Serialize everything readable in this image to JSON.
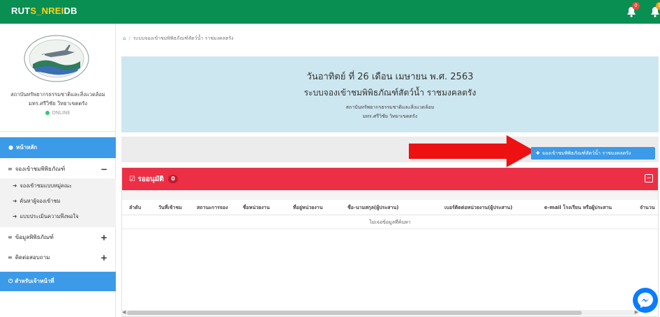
{
  "brand": {
    "part1": "RUT",
    "part2": "S_NREI",
    "part3": "DB"
  },
  "notifications": [
    {
      "count": "0"
    },
    {
      "count": "0"
    }
  ],
  "sidebar": {
    "org_line1": "สถาบันทรัพยากรธรรมชาติและสิ่งแวดล้อม",
    "org_line2": "มทร.ศรีวิชัย วิทยาเขตตรัง",
    "status": "ONLINE",
    "home": "หน้าหลัก",
    "group1": {
      "label": "จองเข้าชมพิพิธภัณฑ์",
      "sign": "−"
    },
    "group1_items": [
      "จองเข้าชมแบบหมู่คณะ",
      "ค้นหาผู้จองเข้าชม",
      "แบบประเมินความพึงพอใจ"
    ],
    "group2": {
      "label": "ข้อมูลพิพิธภัณฑ์",
      "sign": "+"
    },
    "group3": {
      "label": "ติดต่อสอบถาม",
      "sign": "+"
    },
    "staff": "สำหรับเจ้าหน้าที่"
  },
  "breadcrumb": {
    "current": "ระบบจองเข้าชมพิพิธภัณฑ์สัตว์น้ำ ราชมงคลตรัง"
  },
  "hero": {
    "date": "วันอาทิตย์ ที่ 26 เดือน เมษายน พ.ศ. 2563",
    "title": "ระบบจองเข้าชมพิพิธภัณฑ์สัตว์น้ำ ราชมงคลตรัง",
    "sub1": "สถาบันทรัพยากรธรรมชาติและสิ่งแวดล้อม",
    "sub2": "มทร.ศรีวิชัย วิทยาเขตตรัง"
  },
  "book_button": "จองเข้าชมพิพิธภัณฑ์สัตว์น้ำ ราชมงคลตรัง",
  "panel": {
    "title": "รออนุมัติ",
    "count": "0",
    "columns": [
      "ลำดับ",
      "วันที่เข้าชม",
      "สถานะการจอง",
      "ชื่อหน่วยงาน",
      "ที่อยู่หน่วยงาน",
      "ชื่อ-นามสกุล(ผู้ประสาน)",
      "เบอร์ติดต่อหน่วยงาน(ผู้ประสาน)",
      "e-mail โรงเรียน หรือผู้ประสาน",
      "จำนวน"
    ],
    "empty_message": "ไม่เจอข้อมูลที่ค้นหา"
  },
  "colors": {
    "topbar": "#0a8f52",
    "accent_blue": "#3c9be8",
    "panel_red": "#ec2f45",
    "hero_bg": "#cde7f1",
    "brand_yellow": "#ffd21a"
  },
  "icons": {
    "home": "home-icon",
    "menu": "bars-icon",
    "arrow": "arrow-right-icon",
    "power": "power-icon",
    "check": "check-square-icon",
    "bell": "bell-icon",
    "messenger": "messenger-icon"
  }
}
